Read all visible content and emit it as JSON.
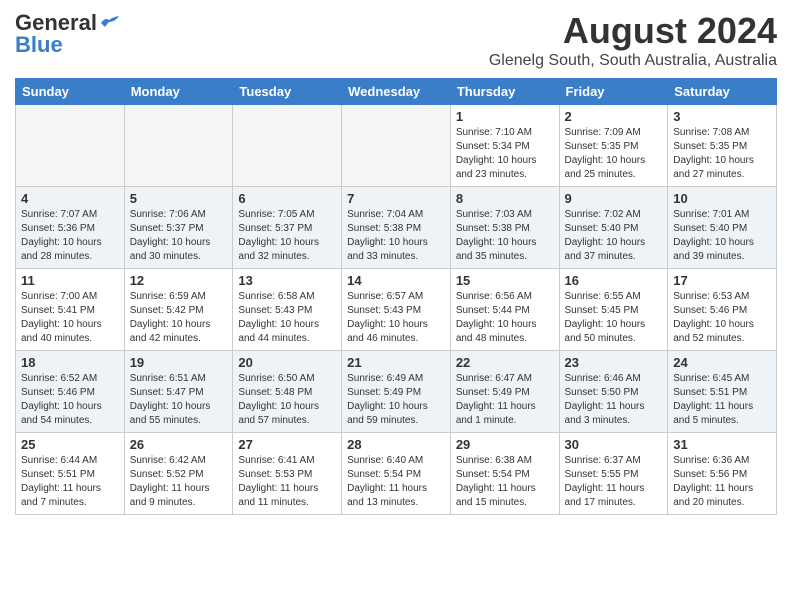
{
  "header": {
    "logo_line1": "General",
    "logo_line2": "Blue",
    "month_title": "August 2024",
    "location": "Glenelg South, South Australia, Australia"
  },
  "weekdays": [
    "Sunday",
    "Monday",
    "Tuesday",
    "Wednesday",
    "Thursday",
    "Friday",
    "Saturday"
  ],
  "weeks": [
    [
      {
        "day": "",
        "empty": true
      },
      {
        "day": "",
        "empty": true
      },
      {
        "day": "",
        "empty": true
      },
      {
        "day": "",
        "empty": true
      },
      {
        "day": "1",
        "sunrise": "7:10 AM",
        "sunset": "5:34 PM",
        "daylight": "10 hours and 23 minutes."
      },
      {
        "day": "2",
        "sunrise": "7:09 AM",
        "sunset": "5:35 PM",
        "daylight": "10 hours and 25 minutes."
      },
      {
        "day": "3",
        "sunrise": "7:08 AM",
        "sunset": "5:35 PM",
        "daylight": "10 hours and 27 minutes."
      }
    ],
    [
      {
        "day": "4",
        "sunrise": "7:07 AM",
        "sunset": "5:36 PM",
        "daylight": "10 hours and 28 minutes."
      },
      {
        "day": "5",
        "sunrise": "7:06 AM",
        "sunset": "5:37 PM",
        "daylight": "10 hours and 30 minutes."
      },
      {
        "day": "6",
        "sunrise": "7:05 AM",
        "sunset": "5:37 PM",
        "daylight": "10 hours and 32 minutes."
      },
      {
        "day": "7",
        "sunrise": "7:04 AM",
        "sunset": "5:38 PM",
        "daylight": "10 hours and 33 minutes."
      },
      {
        "day": "8",
        "sunrise": "7:03 AM",
        "sunset": "5:38 PM",
        "daylight": "10 hours and 35 minutes."
      },
      {
        "day": "9",
        "sunrise": "7:02 AM",
        "sunset": "5:40 PM",
        "daylight": "10 hours and 37 minutes."
      },
      {
        "day": "10",
        "sunrise": "7:01 AM",
        "sunset": "5:40 PM",
        "daylight": "10 hours and 39 minutes."
      }
    ],
    [
      {
        "day": "11",
        "sunrise": "7:00 AM",
        "sunset": "5:41 PM",
        "daylight": "10 hours and 40 minutes."
      },
      {
        "day": "12",
        "sunrise": "6:59 AM",
        "sunset": "5:42 PM",
        "daylight": "10 hours and 42 minutes."
      },
      {
        "day": "13",
        "sunrise": "6:58 AM",
        "sunset": "5:43 PM",
        "daylight": "10 hours and 44 minutes."
      },
      {
        "day": "14",
        "sunrise": "6:57 AM",
        "sunset": "5:43 PM",
        "daylight": "10 hours and 46 minutes."
      },
      {
        "day": "15",
        "sunrise": "6:56 AM",
        "sunset": "5:44 PM",
        "daylight": "10 hours and 48 minutes."
      },
      {
        "day": "16",
        "sunrise": "6:55 AM",
        "sunset": "5:45 PM",
        "daylight": "10 hours and 50 minutes."
      },
      {
        "day": "17",
        "sunrise": "6:53 AM",
        "sunset": "5:46 PM",
        "daylight": "10 hours and 52 minutes."
      }
    ],
    [
      {
        "day": "18",
        "sunrise": "6:52 AM",
        "sunset": "5:46 PM",
        "daylight": "10 hours and 54 minutes."
      },
      {
        "day": "19",
        "sunrise": "6:51 AM",
        "sunset": "5:47 PM",
        "daylight": "10 hours and 55 minutes."
      },
      {
        "day": "20",
        "sunrise": "6:50 AM",
        "sunset": "5:48 PM",
        "daylight": "10 hours and 57 minutes."
      },
      {
        "day": "21",
        "sunrise": "6:49 AM",
        "sunset": "5:49 PM",
        "daylight": "10 hours and 59 minutes."
      },
      {
        "day": "22",
        "sunrise": "6:47 AM",
        "sunset": "5:49 PM",
        "daylight": "11 hours and 1 minute."
      },
      {
        "day": "23",
        "sunrise": "6:46 AM",
        "sunset": "5:50 PM",
        "daylight": "11 hours and 3 minutes."
      },
      {
        "day": "24",
        "sunrise": "6:45 AM",
        "sunset": "5:51 PM",
        "daylight": "11 hours and 5 minutes."
      }
    ],
    [
      {
        "day": "25",
        "sunrise": "6:44 AM",
        "sunset": "5:51 PM",
        "daylight": "11 hours and 7 minutes."
      },
      {
        "day": "26",
        "sunrise": "6:42 AM",
        "sunset": "5:52 PM",
        "daylight": "11 hours and 9 minutes."
      },
      {
        "day": "27",
        "sunrise": "6:41 AM",
        "sunset": "5:53 PM",
        "daylight": "11 hours and 11 minutes."
      },
      {
        "day": "28",
        "sunrise": "6:40 AM",
        "sunset": "5:54 PM",
        "daylight": "11 hours and 13 minutes."
      },
      {
        "day": "29",
        "sunrise": "6:38 AM",
        "sunset": "5:54 PM",
        "daylight": "11 hours and 15 minutes."
      },
      {
        "day": "30",
        "sunrise": "6:37 AM",
        "sunset": "5:55 PM",
        "daylight": "11 hours and 17 minutes."
      },
      {
        "day": "31",
        "sunrise": "6:36 AM",
        "sunset": "5:56 PM",
        "daylight": "11 hours and 20 minutes."
      }
    ]
  ]
}
